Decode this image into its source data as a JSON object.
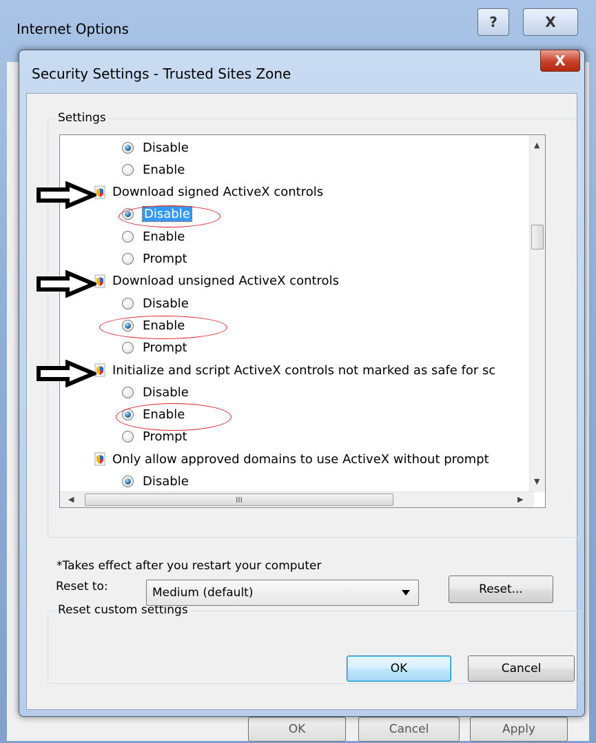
{
  "parent_window": {
    "title": "Internet Options",
    "help_label": "?",
    "close_label": "X",
    "buttons": [
      "OK",
      "Cancel",
      "Apply"
    ]
  },
  "dialog": {
    "title": "Security Settings - Trusted Sites Zone",
    "close_label": "X",
    "settings_group_label": "Settings",
    "settings_items": [
      {
        "type": "option",
        "label": "Disable",
        "checked": true
      },
      {
        "type": "option",
        "label": "Enable",
        "checked": false
      },
      {
        "type": "header",
        "label": "Download signed ActiveX controls"
      },
      {
        "type": "option",
        "label": "Disable",
        "checked": true,
        "selected": true
      },
      {
        "type": "option",
        "label": "Enable",
        "checked": false
      },
      {
        "type": "option",
        "label": "Prompt",
        "checked": false
      },
      {
        "type": "header",
        "label": "Download unsigned ActiveX controls"
      },
      {
        "type": "option",
        "label": "Disable",
        "checked": false
      },
      {
        "type": "option",
        "label": "Enable",
        "checked": true
      },
      {
        "type": "option",
        "label": "Prompt",
        "checked": false
      },
      {
        "type": "header",
        "label": "Initialize and script ActiveX controls not marked as safe for sc"
      },
      {
        "type": "option",
        "label": "Disable",
        "checked": false
      },
      {
        "type": "option",
        "label": "Enable",
        "checked": true
      },
      {
        "type": "option",
        "label": "Prompt",
        "checked": false
      },
      {
        "type": "header",
        "label": "Only allow approved domains to use ActiveX without prompt"
      },
      {
        "type": "option",
        "label": "Disable",
        "checked": true
      }
    ],
    "hscroll_grip": "III",
    "restart_note": "*Takes effect after you restart your computer",
    "reset_group_label": "Reset custom settings",
    "reset_to_label": "Reset to:",
    "reset_to_value": "Medium (default)",
    "reset_button": "Reset...",
    "ok_button": "OK",
    "cancel_button": "Cancel"
  },
  "colors": {
    "annotation_red": "#e0202a",
    "selection_blue": "#3399ff",
    "arrow_black": "#000000"
  }
}
